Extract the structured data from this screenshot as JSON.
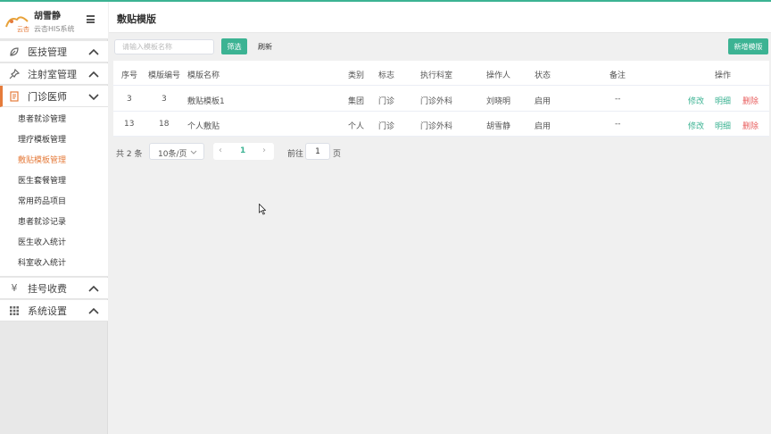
{
  "sidebar": {
    "user_name": "胡雪静",
    "system_name": "云杏HIS系统",
    "logo_text": "云杏",
    "groups": [
      {
        "label": "医技管理",
        "icon": "leaf-icon"
      },
      {
        "label": "注射室管理",
        "icon": "pin-icon"
      },
      {
        "label": "门诊医师",
        "icon": "document-icon"
      },
      {
        "label": "挂号收费",
        "icon": "yen-icon"
      },
      {
        "label": "系统设置",
        "icon": "grid-icon"
      }
    ],
    "sub_items": [
      {
        "label": "患者就诊管理"
      },
      {
        "label": "理疗模板管理"
      },
      {
        "label": "敷贴模板管理"
      },
      {
        "label": "医生套餐管理"
      },
      {
        "label": "常用药品项目"
      },
      {
        "label": "患者就诊记录"
      },
      {
        "label": "医生收入统计"
      },
      {
        "label": "科室收入统计"
      }
    ],
    "active_sub": "敷贴模板管理",
    "accent_color": "#e57b3b"
  },
  "header": {
    "title": "敷贴模版"
  },
  "toolbar": {
    "search_placeholder": "请输入模板名称",
    "filter_label": "筛选",
    "refresh_label": "刷新",
    "add_label": "新增模版"
  },
  "table": {
    "columns": [
      "序号",
      "模版编号",
      "模版名称",
      "类别",
      "标志",
      "执行科室",
      "操作人",
      "状态",
      "备注",
      "操作"
    ],
    "rows": [
      {
        "index": "3",
        "code": "3",
        "name": "敷贴模板1",
        "category": "集团",
        "flag": "门诊",
        "dept": "门诊外科",
        "operator": "刘晓明",
        "status": "启用",
        "remark": "--"
      },
      {
        "index": "13",
        "code": "18",
        "name": "个人敷贴",
        "category": "个人",
        "flag": "门诊",
        "dept": "门诊外科",
        "operator": "胡雪静",
        "status": "启用",
        "remark": "--"
      }
    ],
    "actions": {
      "edit": "修改",
      "detail": "明细",
      "delete": "删除"
    }
  },
  "pager": {
    "total": "共 2 条",
    "page_size": "10条/页",
    "current_page": "1",
    "goto_label": "前往",
    "goto_value": "1",
    "goto_unit": "页"
  },
  "colors": {
    "primary": "#3cb393",
    "danger": "#e85d5d",
    "accent": "#e57b3b"
  }
}
